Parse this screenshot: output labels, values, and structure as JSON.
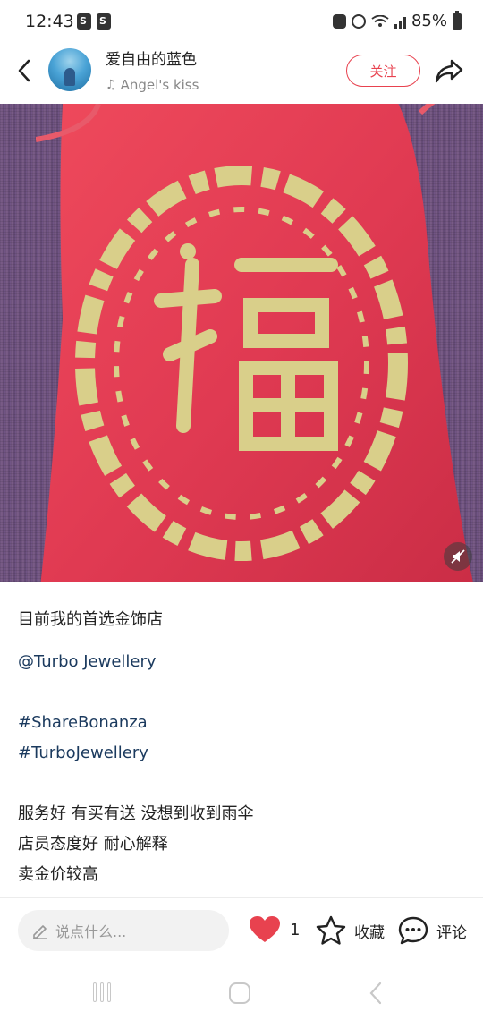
{
  "status_bar": {
    "time": "12:43",
    "battery": "85%"
  },
  "header": {
    "user_name": "爱自由的蓝色",
    "music_title": "Angel's kiss",
    "follow_label": "关注"
  },
  "caption": {
    "title": "目前我的首选金饰店",
    "mention": "@Turbo Jewellery",
    "hashtags": [
      "#ShareBonanza",
      "#TurboJewellery"
    ],
    "lines": [
      "服务好 有买有送 没想到收到雨伞",
      "店员态度好 耐心解释",
      "卖金价较高"
    ]
  },
  "bottom_bar": {
    "comment_placeholder": "说点什么...",
    "like_count": "1",
    "favorite_label": "收藏",
    "comment_label": "评论"
  },
  "colors": {
    "accent": "#e8424f",
    "link": "#1b3a5e",
    "pouch_red": "#e03a52",
    "embroidery_gold": "#d9cf8a"
  }
}
